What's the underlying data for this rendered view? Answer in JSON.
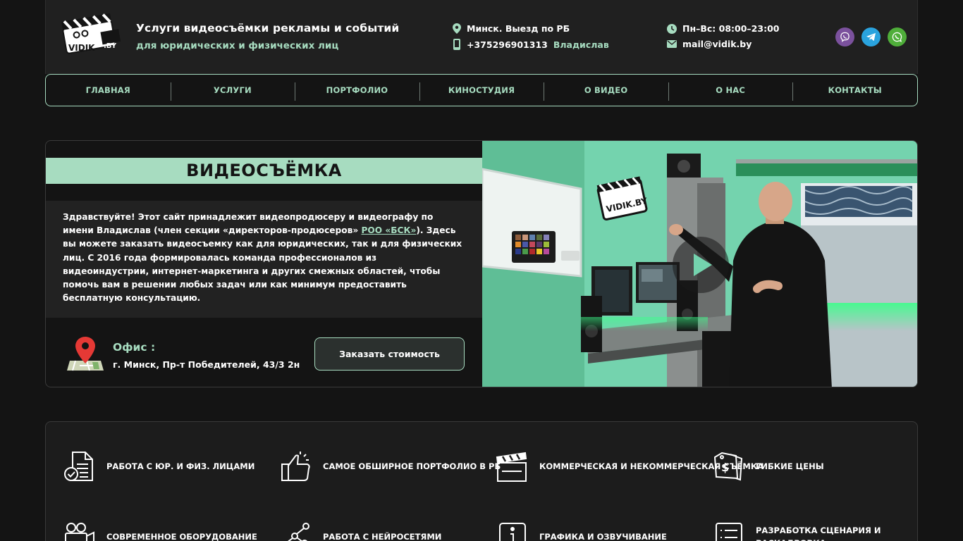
{
  "header": {
    "logo_text": "VIDIK.BY",
    "tagline_main": "Услуги видеосъёмки рекламы и событий",
    "tagline_sub": "для юридических и физических лиц",
    "location": "Минск. Выезд по РБ",
    "phone": "+375296901313",
    "contact_name": "Владислав",
    "hours": "Пн–Вс: 08:00–23:00",
    "email": "mail@vidik.by",
    "messengers": [
      "viber-icon",
      "telegram-icon",
      "whatsapp-icon"
    ]
  },
  "nav": {
    "items": [
      "ГЛАВНАЯ",
      "УСЛУГИ",
      "ПОРТФОЛИО",
      "КИНОСТУДИЯ",
      "О ВИДЕО",
      "О НАС",
      "КОНТАКТЫ"
    ]
  },
  "hero": {
    "title": "ВИДЕОСЪЁМКА",
    "intro_part1": "Здравствуйте! Этот сайт принадлежит видеопродюсеру и видеографу по имени Владислав (член секции «директоров-продюсеров» ",
    "intro_link": "РОО «БСК»",
    "intro_part2": "). Здесь вы можете заказать видеосъемку как для юридических, так и для физических лиц. С 2016 года формировалась команда профессионалов из видеоиндустрии, интернет-маркетинга и других смежных областей, чтобы помочь вам в решении любых задач или как минимум предоставить бесплатную консультацию.",
    "office_label": "Офис :",
    "office_address": "г. Минск, Пр-т Победителей, 43/3 2н",
    "cta_label": "Заказать стоимость",
    "image_logo_text": "VIDIK.BY"
  },
  "features": [
    {
      "icon": "document-check-icon",
      "label": "РАБОТА С ЮР. И ФИЗ. ЛИЦАМИ"
    },
    {
      "icon": "thumbs-up-icon",
      "label": "САМОЕ ОБШИРНОЕ ПОРТФОЛИО В РБ"
    },
    {
      "icon": "clapperboard-icon",
      "label": "КОММЕРЧЕСКАЯ И НЕКОММЕРЧЕСКАЯ СЪЁМКА"
    },
    {
      "icon": "price-tag-icon",
      "label": "ГИБКИЕ ЦЕНЫ"
    },
    {
      "icon": "camera-crew-icon",
      "label": "СОВРЕМЕННОЕ ОБОРУДОВАНИЕ"
    },
    {
      "icon": "neural-network-icon",
      "label": "РАБОТА С НЕЙРОСЕТЯМИ"
    },
    {
      "icon": "info-icon",
      "label": "ГРАФИКА И ОЗВУЧИВАНИЕ"
    },
    {
      "icon": "script-list-icon",
      "label": "РАЗРАБОТКА СЦЕНАРИЯ И РАСКАДРОВКА"
    }
  ],
  "colors": {
    "accent": "#a7dcc0",
    "background": "#141414",
    "panel": "#202020",
    "pin": "#e53935",
    "viber": "#7b519d",
    "telegram": "#2aa3de",
    "whatsapp": "#4fae3a"
  }
}
